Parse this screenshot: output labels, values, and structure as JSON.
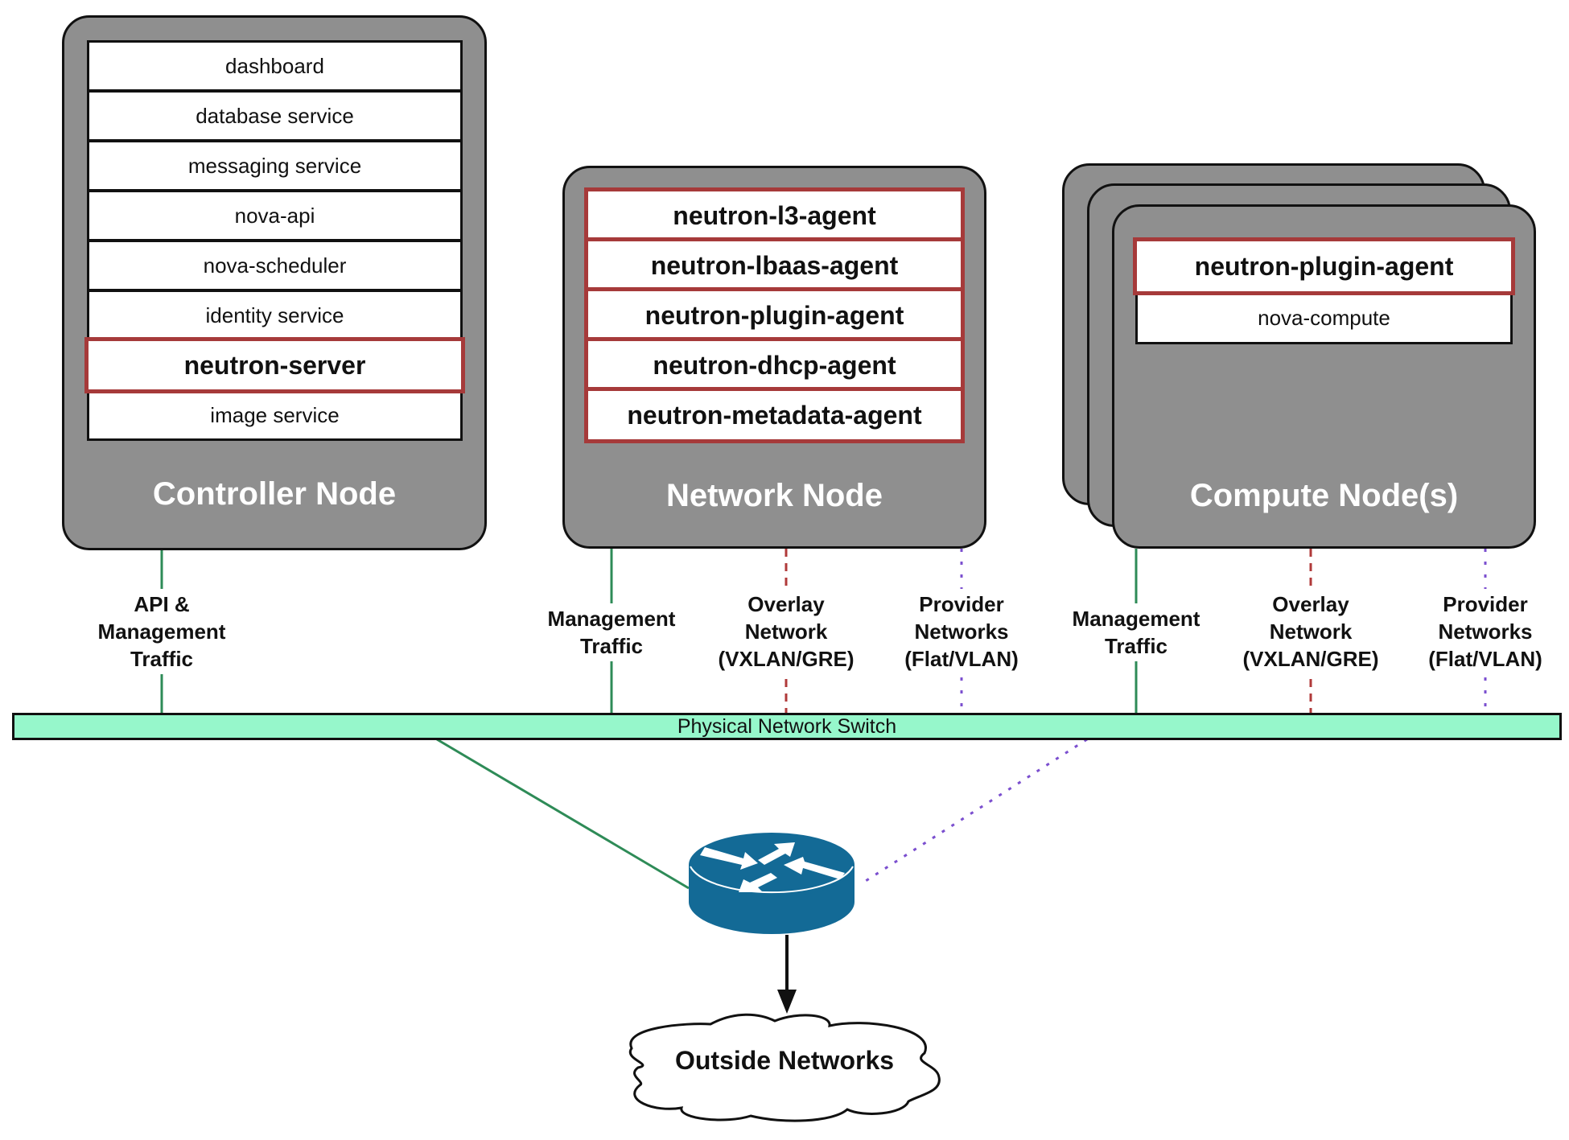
{
  "controller": {
    "title": "Controller Node",
    "services": [
      {
        "label": "dashboard",
        "highlight": false
      },
      {
        "label": "database service",
        "highlight": false
      },
      {
        "label": "messaging service",
        "highlight": false
      },
      {
        "label": "nova-api",
        "highlight": false
      },
      {
        "label": "nova-scheduler",
        "highlight": false
      },
      {
        "label": "identity service",
        "highlight": false
      },
      {
        "label": "neutron-server",
        "highlight": true
      },
      {
        "label": "image service",
        "highlight": false
      }
    ]
  },
  "network": {
    "title": "Network Node",
    "services": [
      {
        "label": "neutron-l3-agent",
        "highlight": true
      },
      {
        "label": "neutron-lbaas-agent",
        "highlight": true
      },
      {
        "label": "neutron-plugin-agent",
        "highlight": true
      },
      {
        "label": "neutron-dhcp-agent",
        "highlight": true
      },
      {
        "label": "neutron-metadata-agent",
        "highlight": true
      }
    ]
  },
  "compute": {
    "title": "Compute Node(s)",
    "services": [
      {
        "label": "neutron-plugin-agent",
        "highlight": true
      },
      {
        "label": "nova-compute",
        "highlight": false
      }
    ]
  },
  "links": {
    "controller_api": [
      "API &",
      "Management",
      "Traffic"
    ],
    "network_mgmt": [
      "Management",
      "Traffic"
    ],
    "network_overlay": [
      "Overlay",
      "Network",
      "(VXLAN/GRE)"
    ],
    "network_provider": [
      "Provider",
      "Networks",
      "(Flat/VLAN)"
    ],
    "compute_mgmt": [
      "Management",
      "Traffic"
    ],
    "compute_overlay": [
      "Overlay",
      "Network",
      "(VXLAN/GRE)"
    ],
    "compute_provider": [
      "Provider",
      "Networks",
      "(Flat/VLAN)"
    ]
  },
  "switch": {
    "label": "Physical Network Switch"
  },
  "router": {
    "icon": "router-icon"
  },
  "outside": {
    "label": "Outside Networks"
  },
  "colors": {
    "node_fill": "#8f8f8f",
    "highlight_border": "#a63a3a",
    "management_line": "#2e8b57",
    "overlay_line": "#b03a3a",
    "provider_line": "#7b4fcf",
    "switch_fill": "#96f7cb",
    "router_fill": "#136a96"
  }
}
